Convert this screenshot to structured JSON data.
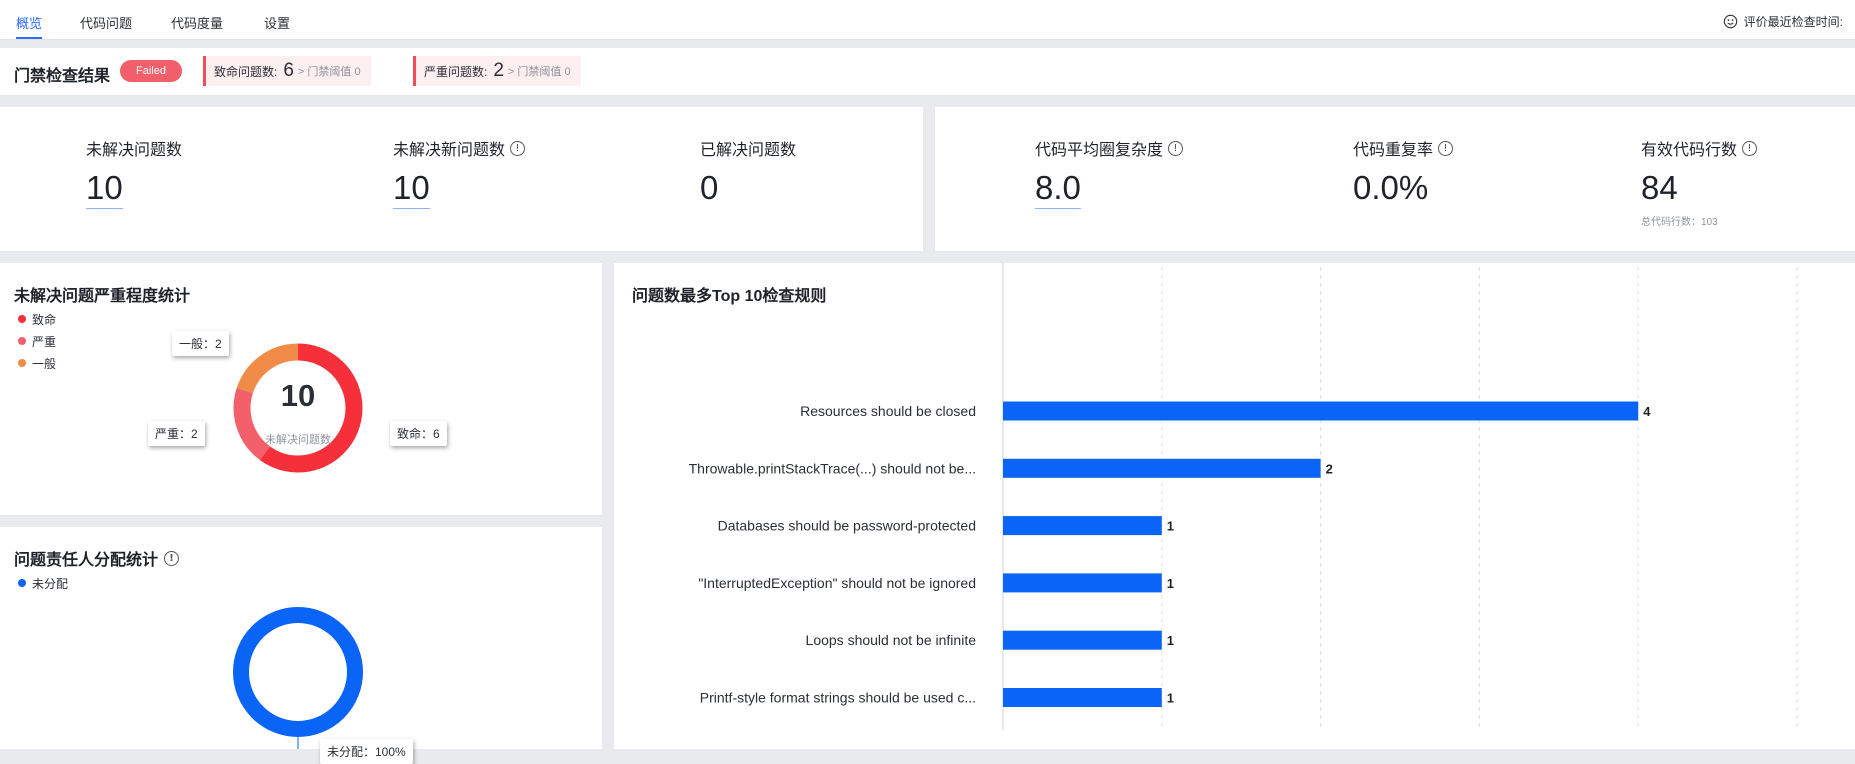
{
  "tabs": [
    {
      "label": "概览",
      "active": true
    },
    {
      "label": "代码问题",
      "active": false
    },
    {
      "label": "代码度量",
      "active": false
    },
    {
      "label": "设置",
      "active": false
    }
  ],
  "last_check": {
    "icon": "smiley-icon",
    "label": "评价最近检查时间:"
  },
  "gate": {
    "title": "门禁检查结果",
    "status": "Failed",
    "fatal": {
      "label": "致命问题数:",
      "count": "6",
      "threshold": "> 门禁阈值 0"
    },
    "serious": {
      "label": "严重问题数:",
      "count": "2",
      "threshold": "> 门禁阈值 0"
    }
  },
  "metrics_left": [
    {
      "label": "未解决问题数",
      "value": "10",
      "info": false
    },
    {
      "label": "未解决新问题数",
      "value": "10",
      "info": true
    },
    {
      "label": "已解决问题数",
      "value": "0",
      "info": false
    }
  ],
  "metrics_right": [
    {
      "label": "代码平均圈复杂度",
      "value": "8.0",
      "info": true
    },
    {
      "label": "代码重复率",
      "value": "0.0%",
      "info": true
    },
    {
      "label": "有效代码行数",
      "value": "84",
      "info": true,
      "sub": "总代码行数：103"
    }
  ],
  "severity": {
    "title": "未解决问题严重程度统计",
    "total": "10",
    "total_label": "未解决问题数",
    "items": [
      {
        "name": "致命",
        "value": 6,
        "color": "#f5303a",
        "tip": "致命：6"
      },
      {
        "name": "严重",
        "value": 2,
        "color": "#f3606a",
        "tip": "严重：2"
      },
      {
        "name": "一般",
        "value": 2,
        "color": "#f08c48",
        "tip": "一般：2"
      }
    ]
  },
  "assignee": {
    "title": "问题责任人分配统计",
    "items": [
      {
        "name": "未分配",
        "value": 10,
        "color": "#0a64f5",
        "tip": "未分配：100%"
      }
    ]
  },
  "chart_data": {
    "type": "bar",
    "orientation": "horizontal",
    "title": "问题数最多Top 10检查规则",
    "categories": [
      "Resources should be closed",
      "Throwable.printStackTrace(...) should not be...",
      "Databases should be password-protected",
      "\"InterruptedException\" should not be ignored",
      "Loops should not be infinite",
      "Printf-style format strings should be used c..."
    ],
    "values": [
      4,
      2,
      1,
      1,
      1,
      1
    ],
    "xlim": [
      0,
      5
    ],
    "ticks": [
      "0",
      "1",
      "2",
      "3",
      "4",
      "5"
    ],
    "color": "#0a64f5",
    "grid": true
  }
}
